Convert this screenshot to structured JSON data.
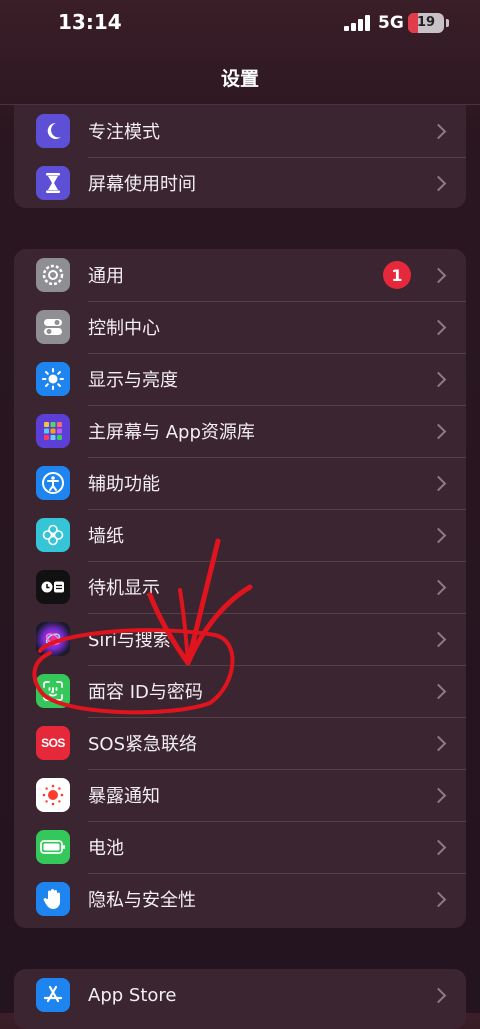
{
  "status": {
    "time": "13:14",
    "network": "5G",
    "battery": "19"
  },
  "nav": {
    "title": "设置"
  },
  "groups": [
    {
      "rows": [
        {
          "label": "专注模式"
        },
        {
          "label": "屏幕使用时间"
        }
      ]
    },
    {
      "rows": [
        {
          "label": "通用",
          "badge": "1"
        },
        {
          "label": "控制中心"
        },
        {
          "label": "显示与亮度"
        },
        {
          "label": "主屏幕与 App资源库"
        },
        {
          "label": "辅助功能"
        },
        {
          "label": "墙纸"
        },
        {
          "label": "待机显示"
        },
        {
          "label": "Siri与搜索"
        },
        {
          "label": "面容 ID与密码"
        },
        {
          "label": "SOS紧急联络"
        },
        {
          "label": "暴露通知"
        },
        {
          "label": "电池"
        },
        {
          "label": "隐私与安全性"
        }
      ]
    },
    {
      "rows": [
        {
          "label": "App Store"
        }
      ]
    }
  ],
  "icons": {
    "focus": "moon-icon",
    "screen_time": "hourglass-icon",
    "general": "gear-icon",
    "control": "toggles-icon",
    "display": "sun-icon",
    "home": "grid-icon",
    "accessibility": "accessibility-icon",
    "wallpaper": "flower-icon",
    "standby": "standby-icon",
    "siri": "siri-icon",
    "faceid": "faceid-icon",
    "sos_text": "SOS",
    "exposure": "exposure-icon",
    "battery": "battery-icon",
    "privacy": "hand-icon",
    "appstore": "appstore-icon"
  }
}
